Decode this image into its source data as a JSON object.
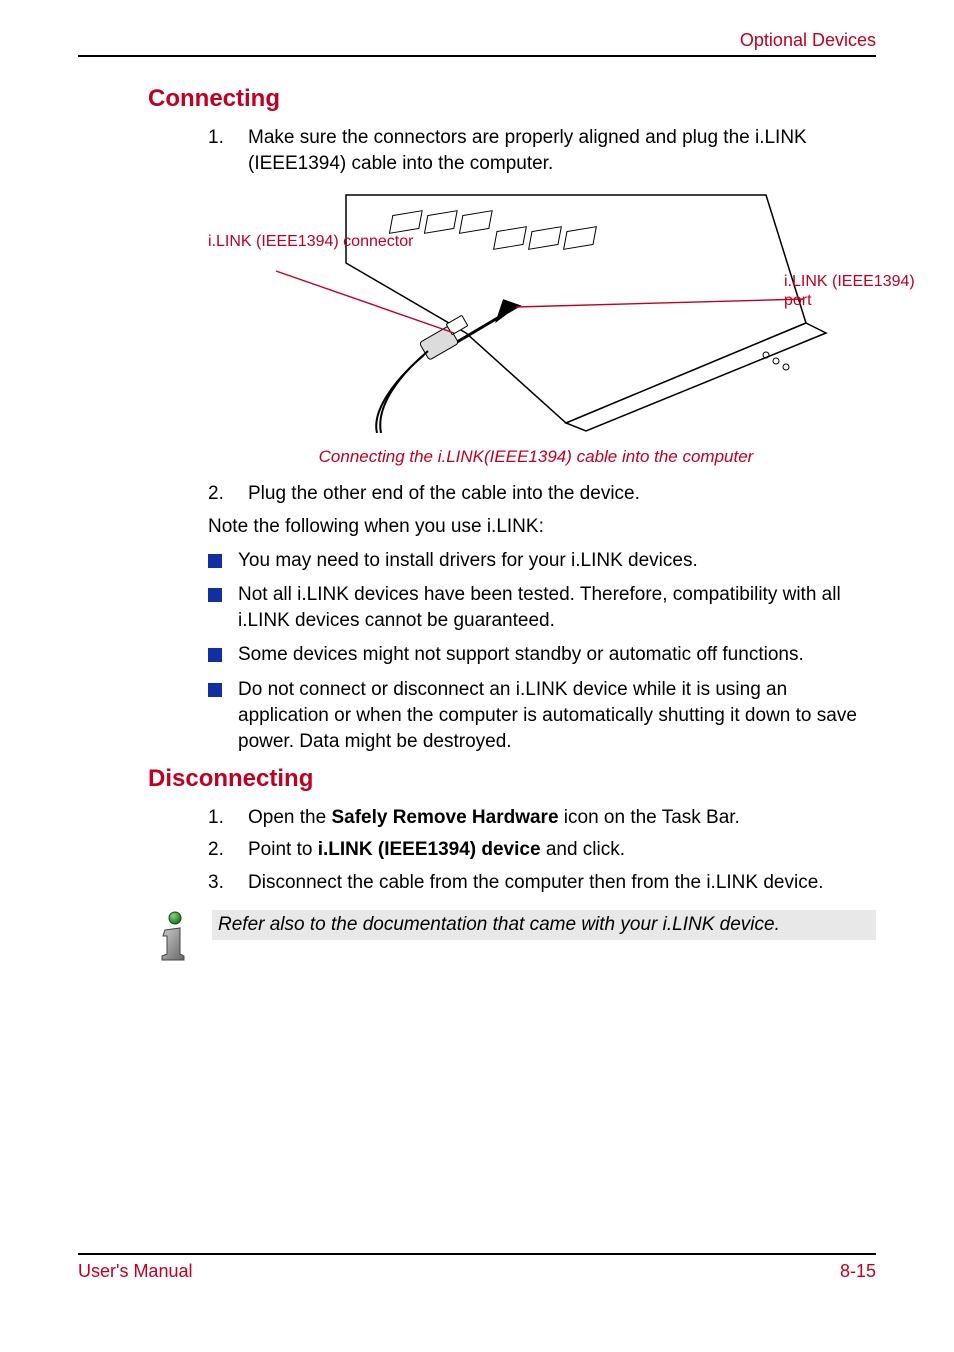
{
  "header": {
    "section": "Optional Devices"
  },
  "sections": {
    "connecting": {
      "heading": "Connecting",
      "step1": "Make sure the connectors are properly aligned and plug the i.LINK (IEEE1394) cable into the computer.",
      "figure": {
        "labelConnector": "i.LINK (IEEE1394) connector",
        "labelPort": "i.LINK (IEEE1394) port",
        "caption": "Connecting the i.LINK(IEEE1394) cable into the computer"
      },
      "step2": "Plug the other end of the cable into the device.",
      "noteIntro": "Note the following when you use i.LINK:",
      "bullets": [
        "You may need to install drivers for your i.LINK devices.",
        "Not all i.LINK devices have been tested. Therefore, compatibility with all i.LINK devices cannot be guaranteed.",
        "Some devices might not support standby or automatic off functions.",
        "Do not connect or disconnect an i.LINK device while it is using an application or when the computer is automatically shutting it down to save power. Data might be destroyed."
      ]
    },
    "disconnecting": {
      "heading": "Disconnecting",
      "step1_pre": "Open the ",
      "step1_bold": "Safely Remove Hardware",
      "step1_post": " icon on the Task Bar.",
      "step2_pre": "Point to ",
      "step2_bold": "i.LINK (IEEE1394) device",
      "step2_post": " and click.",
      "step3": "Disconnect the cable from the computer then from the i.LINK device."
    }
  },
  "infoNote": "Refer also to the documentation that came with your i.LINK device.",
  "footer": {
    "left": "User's Manual",
    "right": "8-15"
  }
}
